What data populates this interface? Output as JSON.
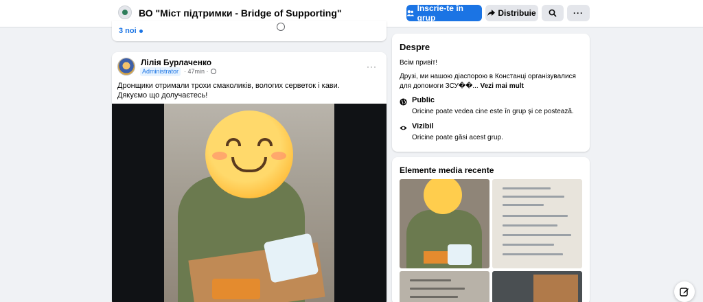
{
  "header": {
    "group_title": "ВО \"Міст підтримки - Bridge of Supporting\"",
    "join_label": "Înscrie-te în grup",
    "share_label": "Distribuie",
    "more_label": "···"
  },
  "previous_post": {
    "label": "3 noi"
  },
  "post": {
    "author": "Лілія Бурлаченко",
    "badge": "Administrator",
    "time": "· 47min ·",
    "menu": "···",
    "text_line1": "Дронщики отримали трохи смаколиків, вологих серветок і кави.",
    "text_line2": "Дякуємо що долучаєтесь!"
  },
  "about": {
    "title": "Despre",
    "greeting": "Всім привіт!",
    "description": "Друзі, ми нашою діаспорою в Констанці організувалися для допомоги ЗСУ��...",
    "see_more": "Vezi mai mult",
    "public_title": "Public",
    "public_desc": "Oricine poate vedea cine este în grup și ce postează.",
    "visible_title": "Vizibil",
    "visible_desc": "Oricine poate găsi acest grup."
  },
  "media": {
    "title": "Elemente media recente"
  },
  "colors": {
    "accent": "#1b74e4",
    "background": "#f0f2f5"
  },
  "icons": [
    "group-avatar",
    "users-icon",
    "share-arrow-icon",
    "search-icon",
    "globe-icon",
    "eye-icon",
    "edit-icon"
  ]
}
